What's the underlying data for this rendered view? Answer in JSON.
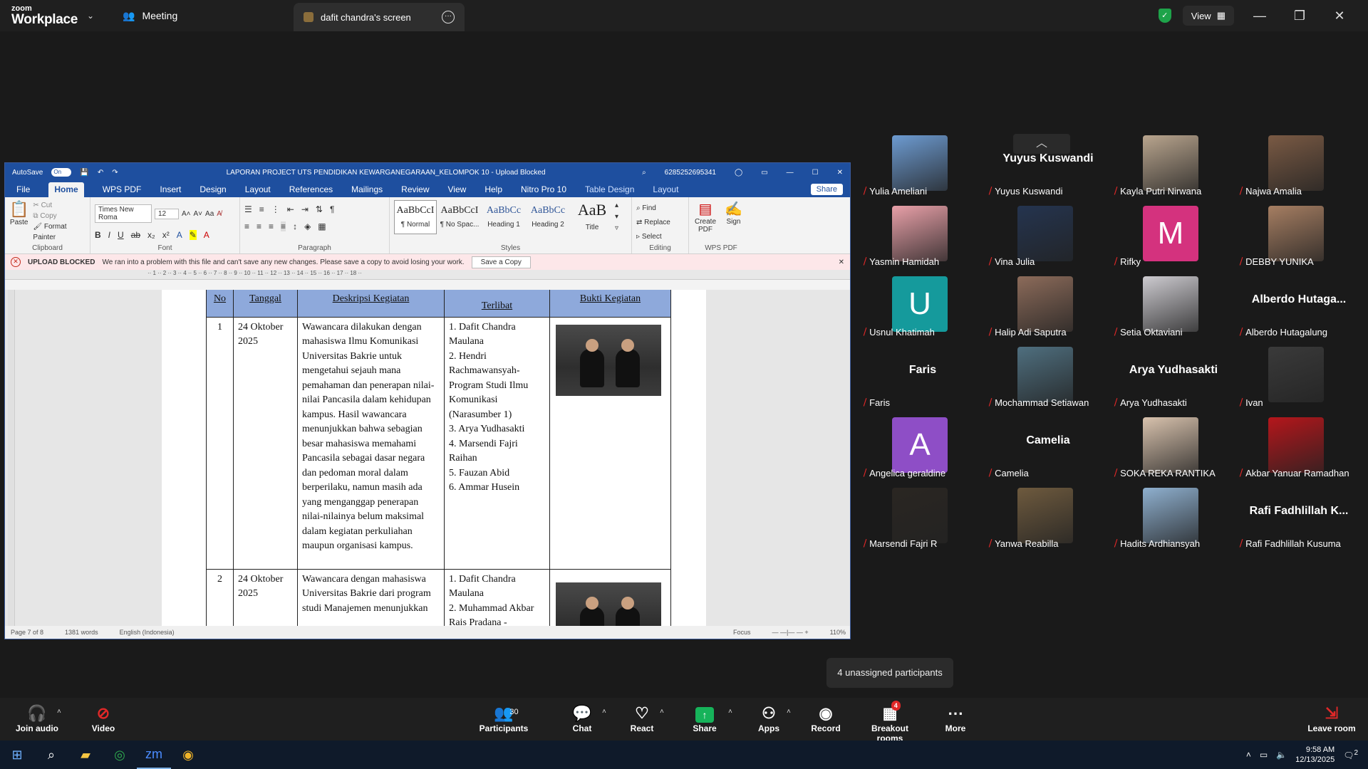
{
  "topbar": {
    "logo_small": "zoom",
    "logo_large": "Workplace",
    "meeting_label": "Meeting",
    "share_tab_label": "dafit chandra's screen",
    "view_label": "View"
  },
  "word": {
    "autosave_label": "AutoSave",
    "autosave_state": "On",
    "doc_title": "LAPORAN PROJECT UTS PENDIDIKAN KEWARGANEGARAAN_KELOMPOK 10 - Upload Blocked",
    "account": "6285252695341",
    "menu": [
      "File",
      "Home",
      "WPS PDF",
      "Insert",
      "Design",
      "Layout",
      "References",
      "Mailings",
      "Review",
      "View",
      "Help",
      "Nitro Pro 10",
      "Table Design",
      "Layout"
    ],
    "share_label": "Share",
    "clipboard": {
      "paste": "Paste",
      "cut": "Cut",
      "copy": "Copy",
      "format_painter": "Format Painter",
      "label": "Clipboard"
    },
    "font": {
      "name": "Times New Roma",
      "size": "12",
      "label": "Font"
    },
    "paragraph_label": "Paragraph",
    "styles": [
      {
        "preview": "AaBbCcI",
        "name": "¶ Normal"
      },
      {
        "preview": "AaBbCcI",
        "name": "¶ No Spac..."
      },
      {
        "preview": "AaBbCc",
        "name": "Heading 1"
      },
      {
        "preview": "AaBbCc",
        "name": "Heading 2"
      },
      {
        "preview": "AaB",
        "name": "Title"
      }
    ],
    "styles_label": "Styles",
    "editing": {
      "find": "Find",
      "replace": "Replace",
      "select": "Select",
      "label": "Editing"
    },
    "wps": {
      "create_pdf": "Create PDF",
      "sign": "Sign",
      "label": "WPS PDF"
    },
    "upload": {
      "title": "UPLOAD BLOCKED",
      "message": "We ran into a problem with this file and can't save any new changes. Please save a copy to avoid losing your work.",
      "button": "Save a Copy"
    },
    "table": {
      "headers": [
        "No",
        "Tanggal",
        "Deskripsi Kegiatan",
        "Terlibat",
        "Bukti Kegiatan"
      ],
      "rows": [
        {
          "no": "1",
          "date": "24 Oktober 2025",
          "desc": "Wawancara dilakukan dengan mahasiswa Ilmu Komunikasi Universitas Bakrie untuk mengetahui sejauh mana pemahaman dan penerapan nilai-nilai Pancasila dalam kehidupan kampus. Hasil wawancara menunjukkan bahwa sebagian besar mahasiswa memahami Pancasila sebagai dasar negara dan pedoman moral dalam berperilaku, namun masih ada yang menganggap penerapan nilai-nilainya belum maksimal dalam kegiatan perkuliahan maupun organisasi kampus.",
          "people": [
            "1. Dafit Chandra Maulana",
            "2. Hendri Rachmawansyah- Program Studi Ilmu Komunikasi (Narasumber 1)",
            "3. Arya Yudhasakti",
            "4. Marsendi Fajri Raihan",
            "5. Fauzan Abid",
            "6. Ammar Husein"
          ]
        },
        {
          "no": "2",
          "date": "24 Oktober 2025",
          "desc": "Wawancara dengan mahasiswa Universitas Bakrie dari program studi Manajemen menunjukkan",
          "people": [
            "1. Dafit Chandra Maulana",
            "2. Muhammad Akbar Rais Pradana -"
          ]
        }
      ]
    },
    "status": {
      "page": "Page 7 of 8",
      "words": "1381 words",
      "language": "English (Indonesia)",
      "focus": "Focus",
      "zoom": "110%"
    }
  },
  "gallery": {
    "participants": [
      {
        "name": "Yulia Ameliani",
        "type": "photo",
        "color": "#6d9bd1"
      },
      {
        "name": "Yuyus Kuswandi",
        "type": "name"
      },
      {
        "name": "Kayla Putri Nirwana",
        "type": "photo",
        "color": "#b9a58e"
      },
      {
        "name": "Najwa Amalia",
        "type": "photo",
        "color": "#7a5a44"
      },
      {
        "name": "Yasmin Hamidah",
        "type": "photo",
        "color": "#e8a0a8"
      },
      {
        "name": "Vina Julia",
        "type": "photo",
        "color": "#24344f"
      },
      {
        "name": "Rifky",
        "type": "initial",
        "initial": "M",
        "color": "#d4327e"
      },
      {
        "name": "DEBBY YUNIKA",
        "type": "photo",
        "color": "#a67e62"
      },
      {
        "name": "Usnul Khatimah",
        "type": "initial",
        "initial": "U",
        "color": "#159a9c"
      },
      {
        "name": "Halip Adi Saputra",
        "type": "photo",
        "color": "#8c6b5a"
      },
      {
        "name": "Setia Oktaviani",
        "type": "photo",
        "color": "#cdcbd0"
      },
      {
        "name": "Alberdo Hutagalung",
        "type": "name",
        "display": "Alberdo Hutaga..."
      },
      {
        "name": "Faris",
        "type": "name"
      },
      {
        "name": "Mochammad Setiawan",
        "type": "photo",
        "color": "#4f6f7f"
      },
      {
        "name": "Arya Yudhasakti",
        "type": "name"
      },
      {
        "name": "Ivan",
        "type": "photo",
        "color": "#3a3a3a"
      },
      {
        "name": "Angelica geraldine",
        "type": "initial",
        "initial": "A",
        "color": "#8e4ec6"
      },
      {
        "name": "Camelia",
        "type": "name"
      },
      {
        "name": "SOKA REKA RANTIKA",
        "type": "photo",
        "color": "#d8c2ad"
      },
      {
        "name": "Akbar Yanuar Ramadhan",
        "type": "photo",
        "color": "#b5161b"
      },
      {
        "name": "Marsendi Fajri R",
        "type": "photo",
        "color": "#2a2622"
      },
      {
        "name": "Yanwa Reabilla",
        "type": "photo",
        "color": "#6e5a3e"
      },
      {
        "name": "Hadits Ardhiansyah",
        "type": "photo",
        "color": "#8fb0cf"
      },
      {
        "name": "Rafi Fadhlillah Kusuma",
        "type": "name",
        "display": "Rafi Fadhlillah K..."
      }
    ],
    "unassigned": "4 unassigned participants"
  },
  "toolbar": {
    "join_audio": "Join audio",
    "video": "Video",
    "participants": "Participants",
    "participants_count": "30",
    "chat": "Chat",
    "react": "React",
    "share": "Share",
    "apps": "Apps",
    "record": "Record",
    "breakout": "Breakout rooms",
    "breakout_badge": "4",
    "more": "More",
    "leave": "Leave room"
  },
  "taskbar": {
    "time": "9:58 AM",
    "date": "12/13/2025",
    "notif": "2"
  }
}
